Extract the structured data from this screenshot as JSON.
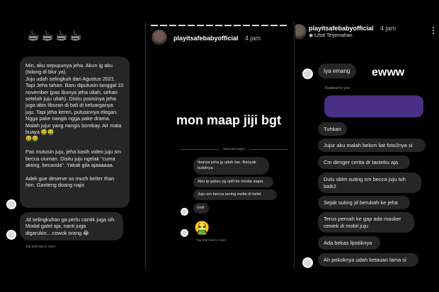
{
  "panel1": {
    "emojis": "☕☕☕☕",
    "message1": "Min, aku sepupunya jeha. Akun ig aku (tolong di blur ya).\nJuju udah selingkuh dari Agustus 2021. Tapi Jeha tahan. Baru diputusin tanggal 10 november (pas ibunya jeha ultah, sehari setelah juju ultah). Disitu posisinya jeha juga abis liburan di bali di keluarganya juju. Tapi jeha keren, putusinnya elegan. Ngga pake nangis ngga pake drama. Malah jujur yang nangis bombay. Air mata buaya 🤮🤮\n🤮🤮\n\nPas mutusin juju, jeha kasih video juju sm becca ciuman. Disitu juju ngelak \"cuma akting, becanda\". Yakali gila ajaaaaaa.\n\nAdek gue deserve so much better than him. Ganteng doang najis",
    "message2": "Jd selingkuhan ga perlu cantik juga sih. Modal gatel aja, nanti juga digarukin....cowok orang 😂",
    "footer": "Tap and hold to react"
  },
  "panel2": {
    "username": "playitsafebabyofficial",
    "time": "4 jam",
    "caption": "mon maap jiji bgt",
    "new_messages": "New Messages",
    "messages": [
      "Ibunya jeha jg udah tau. Banyak buktinya",
      "Aku tp gatau yg spill ke media siapa",
      "Juju sm becca sering ewita di toilet",
      "Geli"
    ],
    "emoji": "🤮",
    "footer": "Tap and hold to react"
  },
  "panel3": {
    "username": "playitsafebabyofficial",
    "time": "4 jam",
    "translate": "Lihat Terjemahan",
    "first_message": "Iya emang",
    "caption": "ewww",
    "replied": "Replied to you",
    "messages": [
      "Tuhkan",
      "Jujur aku malah belom liat foto2nya si",
      "Cm denger cerita dr tanteku aja",
      "Dulu sblm suting sm becca juju tuh baik2",
      "Sejak suting jd berubah ke jeha",
      "Terus pernah ke gap ada masker cewek di mobil juju",
      "Ada bekas lipstiknya",
      "Ah pokoknya udah ketauan lama si"
    ]
  }
}
